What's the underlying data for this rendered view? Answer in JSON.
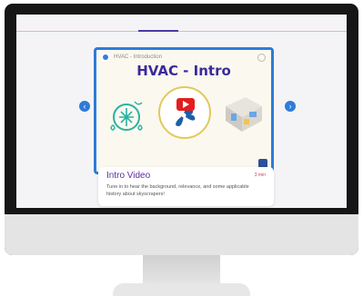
{
  "video": {
    "channel_title": "HVAC - Introduction",
    "heading": "HVAC - Intro"
  },
  "card": {
    "title": "Intro Video",
    "duration": "3 min",
    "description": "Tune in to hear the background, relevance, and some applicable history about skyscrapers!"
  },
  "colors": {
    "accent": "#2e7bd8",
    "heading": "#3b2a9a",
    "card_title": "#5b2f9c",
    "duration": "#d2386a",
    "play": "#e51d1d"
  },
  "icons": [
    "left-arrow-icon",
    "right-arrow-icon",
    "play-icon",
    "hvac-icon",
    "fan-icon",
    "room-icon"
  ]
}
